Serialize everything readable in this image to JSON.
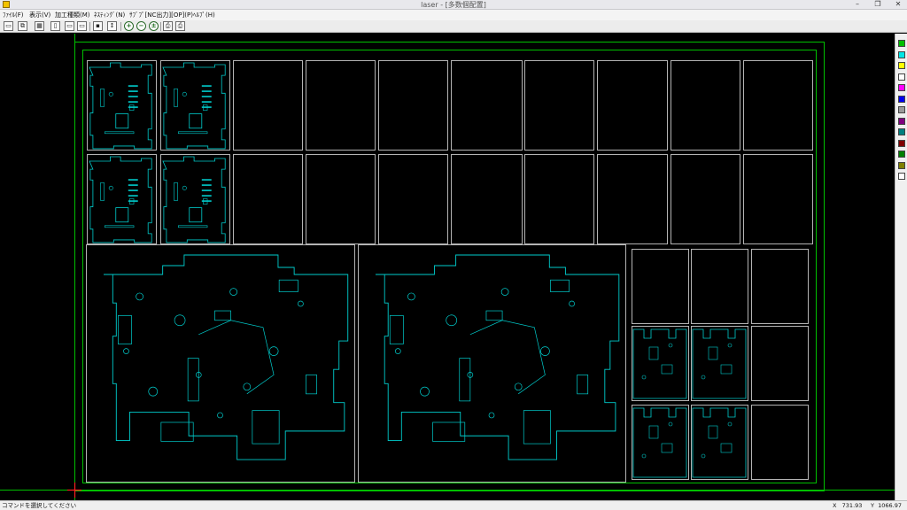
{
  "window": {
    "title": "laser - [多数個配置]",
    "minimize_glyph": "–",
    "restore_glyph": "❐",
    "close_glyph": "✕"
  },
  "menu": [
    {
      "label": "ﾌｧｲﾙ(F)"
    },
    {
      "label": "表示(V)"
    },
    {
      "label": "加工種類(M)"
    },
    {
      "label": "ﾈｽﾃｨﾝｸﾞ(N)"
    },
    {
      "label": "ｻﾌﾞﾌﾟ[NC出力][OP](P)"
    },
    {
      "label": "ﾍﾙﾌﾟ(H)"
    }
  ],
  "toolbar": [
    {
      "icon": "new-sheet-icon",
      "glyph": "▭"
    },
    {
      "icon": "copy-parts-icon",
      "glyph": "⧉"
    },
    {
      "icon": "grid-icon",
      "glyph": "▦"
    },
    {
      "icon": "page-icon",
      "glyph": "▯"
    },
    {
      "icon": "frame-icon",
      "glyph": "▭"
    },
    {
      "icon": "frame-alt-icon",
      "glyph": "▭"
    },
    {
      "icon": "save-icon",
      "glyph": "▪"
    },
    {
      "icon": "cursor-icon",
      "glyph": "↕"
    },
    {
      "icon": "zoom-in-icon",
      "glyph": "+"
    },
    {
      "icon": "zoom-out-icon",
      "glyph": "−"
    },
    {
      "icon": "zoom-fit-icon",
      "glyph": "±"
    },
    {
      "icon": "print-preview-icon",
      "glyph": "⎙"
    },
    {
      "icon": "print-icon",
      "glyph": "⎙"
    }
  ],
  "palette": [
    {
      "name": "green",
      "color": "#00c000"
    },
    {
      "name": "cyan",
      "color": "#00e5e5"
    },
    {
      "name": "yellow",
      "color": "#ffff00"
    },
    {
      "name": "white",
      "color": "#ffffff"
    },
    {
      "name": "magenta",
      "color": "#ff00ff"
    },
    {
      "name": "blue",
      "color": "#0000ee"
    },
    {
      "name": "gray",
      "color": "#9a9a9a"
    },
    {
      "name": "purple",
      "color": "#800080"
    },
    {
      "name": "teal",
      "color": "#008080"
    },
    {
      "name": "maroon",
      "color": "#800000"
    },
    {
      "name": "dark-green",
      "color": "#008000"
    },
    {
      "name": "olive",
      "color": "#808000"
    },
    {
      "name": "white-2",
      "color": "#ffffff"
    }
  ],
  "colors": {
    "sheet_outline": "#00c000",
    "part_outline": "#00cccc",
    "blank_outline": "#b4b4b4",
    "origin_marker": "#ff2020"
  },
  "status": {
    "message": "コマンドを選択してください",
    "x_label": "X",
    "x_value": "731.93",
    "y_label": "Y",
    "y_value": "1066.97"
  }
}
